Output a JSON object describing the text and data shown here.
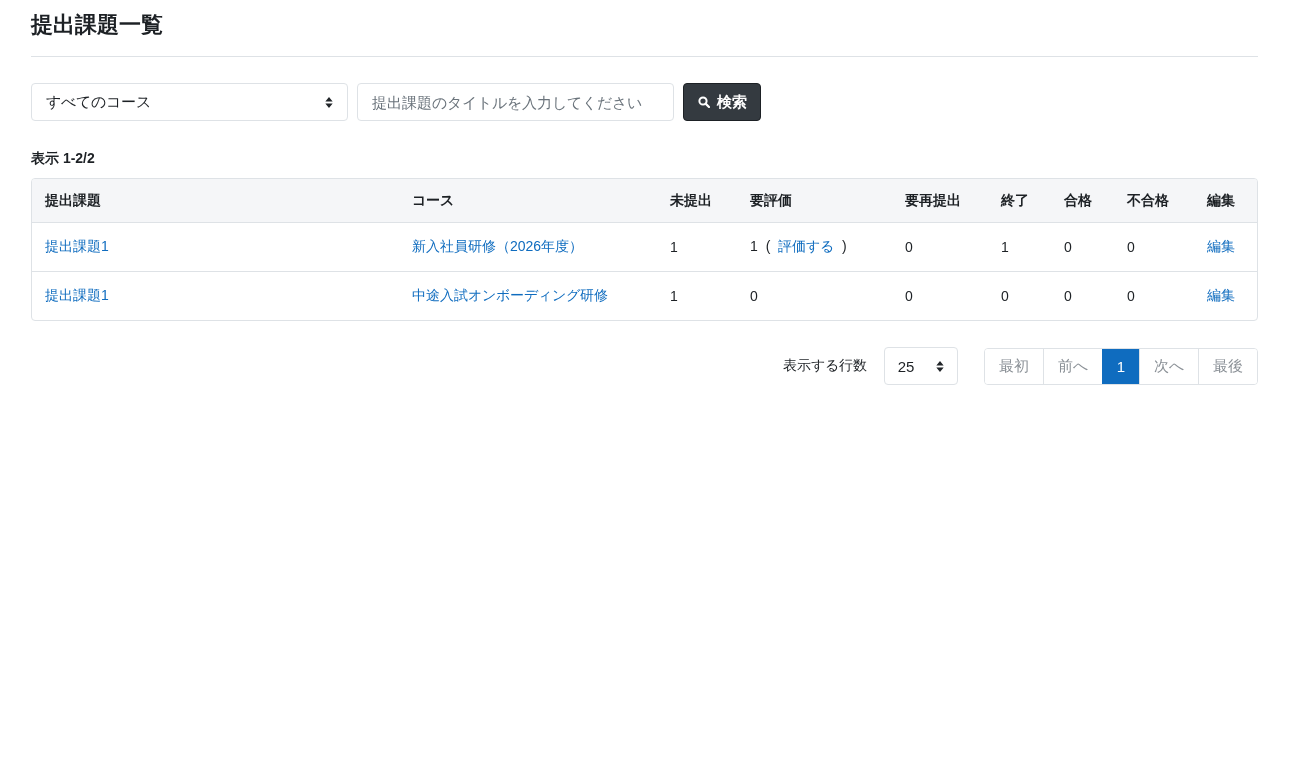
{
  "page": {
    "title": "提出課題一覧"
  },
  "filters": {
    "course_select": {
      "value": "すべてのコース"
    },
    "search": {
      "placeholder": "提出課題のタイトルを入力してください"
    },
    "search_button": "検索"
  },
  "summary": "表示 1-2/2",
  "table": {
    "columns": [
      "提出課題",
      "コース",
      "未提出",
      "要評価",
      "要再提出",
      "終了",
      "合格",
      "不合格",
      "編集"
    ],
    "rows": [
      {
        "cells": [
          {
            "kind": "link",
            "text": "提出課題1"
          },
          {
            "kind": "link",
            "text": "新入社員研修（2026年度）"
          },
          {
            "kind": "text",
            "text": "1"
          },
          {
            "kind": "text_link",
            "text": "1 (",
            "link": "評価する",
            "after": ")"
          },
          {
            "kind": "text",
            "text": "0"
          },
          {
            "kind": "text",
            "text": "1"
          },
          {
            "kind": "text",
            "text": "0"
          },
          {
            "kind": "text",
            "text": "0"
          },
          {
            "kind": "link",
            "text": "編集"
          }
        ]
      },
      {
        "cells": [
          {
            "kind": "link",
            "text": "提出課題1"
          },
          {
            "kind": "link",
            "text": "中途入試オンボーディング研修"
          },
          {
            "kind": "text",
            "text": "1"
          },
          {
            "kind": "text",
            "text": "0"
          },
          {
            "kind": "text",
            "text": "0"
          },
          {
            "kind": "text",
            "text": "0"
          },
          {
            "kind": "text",
            "text": "0"
          },
          {
            "kind": "text",
            "text": "0"
          },
          {
            "kind": "link",
            "text": "編集"
          }
        ]
      }
    ]
  },
  "pagination": {
    "rows_label": "表示する行数",
    "rows_select": {
      "value": "25"
    },
    "pages": [
      {
        "label": "最初",
        "selected": false,
        "disabled": true
      },
      {
        "label": "前へ",
        "selected": false,
        "disabled": true
      },
      {
        "label": "1",
        "selected": true,
        "disabled": false
      },
      {
        "label": "次へ",
        "selected": false,
        "disabled": true
      },
      {
        "label": "最後",
        "selected": false,
        "disabled": true
      }
    ]
  }
}
